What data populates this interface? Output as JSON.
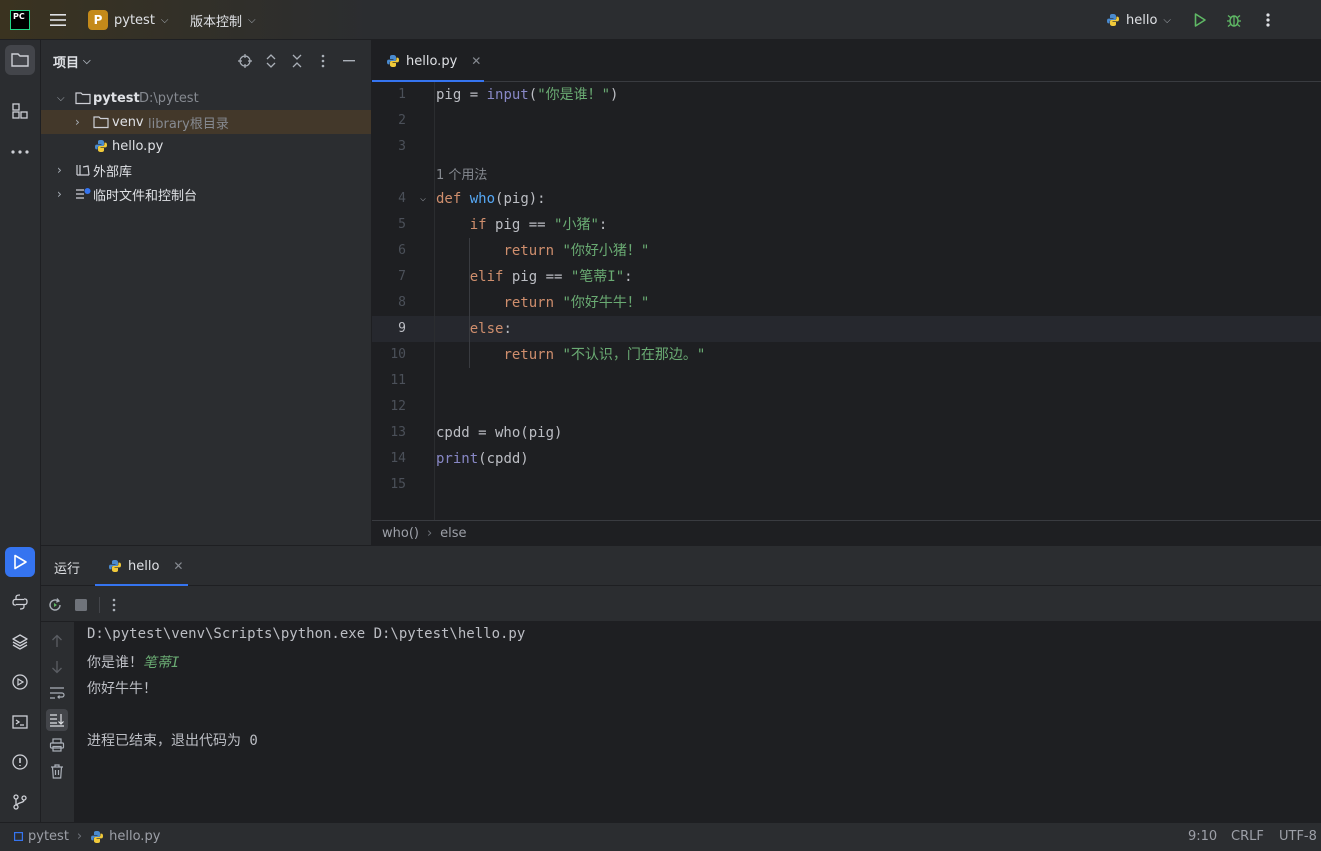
{
  "titlebar": {
    "logo_text": "PC",
    "project_badge": "P",
    "project_name": "pytest",
    "vcs_menu": "版本控制",
    "run_config": "hello"
  },
  "project_panel": {
    "title": "项目",
    "tree": [
      {
        "label": "pytest",
        "hint": "D:\\pytest"
      },
      {
        "label": "venv",
        "hint": "library根目录"
      },
      {
        "label": "hello.py",
        "hint": ""
      },
      {
        "label": "外部库",
        "hint": ""
      },
      {
        "label": "临时文件和控制台",
        "hint": ""
      }
    ]
  },
  "editor": {
    "tab_label": "hello.py",
    "usage_hint": "1 个用法",
    "line_numbers": [
      "1",
      "2",
      "3",
      "4",
      "5",
      "6",
      "7",
      "8",
      "9",
      "10",
      "11",
      "12",
      "13",
      "14",
      "15"
    ],
    "code": {
      "l1_var": "pig",
      "l1_eq": " = ",
      "l1_fn": "input",
      "l1_open": "(",
      "l1_str": "\"你是谁！\"",
      "l1_close": ")",
      "l4_kw": "def",
      "l4_fn": "who",
      "l4_rest": "(pig):",
      "l5_kw": "if",
      "l5_rest": " pig == ",
      "l5_str": "\"小猪\"",
      "l5_colon": ":",
      "l6_kw": "return",
      "l6_str": "\"你好小猪！\"",
      "l7_kw": "elif",
      "l7_rest": " pig == ",
      "l7_str": "\"笔蒂I\"",
      "l7_colon": ":",
      "l8_kw": "return",
      "l8_str": "\"你好牛牛！\"",
      "l9_kw": "else",
      "l9_colon": ":",
      "l10_kw": "return",
      "l10_str": "\"不认识，门在那边。\"",
      "l13_text": "cpdd = who(pig)",
      "l14_fn": "print",
      "l14_rest": "(cpdd)"
    },
    "breadcrumb": [
      "who()",
      "else"
    ]
  },
  "run_panel": {
    "tab_run": "运行",
    "tab_hello": "hello",
    "console": {
      "cmd": "D:\\pytest\\venv\\Scripts\\python.exe D:\\pytest\\hello.py",
      "prompt": "你是谁！",
      "input": "笔蒂I",
      "output": "你好牛牛！",
      "exit": "进程已结束，退出代码为 0"
    }
  },
  "statusbar": {
    "project": "pytest",
    "file": "hello.py",
    "position": "9:10",
    "line_ending": "CRLF",
    "encoding": "UTF-8"
  }
}
